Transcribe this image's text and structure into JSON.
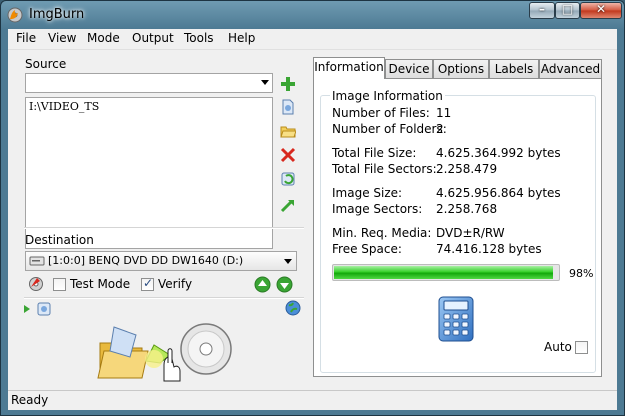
{
  "window": {
    "title": "ImgBurn"
  },
  "titlebar_buttons": {
    "minimize": "–",
    "maximize": "□",
    "close": "✕"
  },
  "menu": [
    "File",
    "View",
    "Mode",
    "Output",
    "Tools",
    "Help"
  ],
  "source": {
    "label": "Source",
    "combo_value": "",
    "entries": [
      "I:\\VIDEO_TS"
    ],
    "side_icons": [
      "add-file-icon",
      "browse-file-icon",
      "browse-folder-icon",
      "remove-icon",
      "refresh-icon",
      "calculate-icon"
    ]
  },
  "destination": {
    "label": "Destination",
    "drive": "[1:0:0] BENQ DVD DD DW1640 (D:)",
    "test_mode": {
      "label": "Test Mode",
      "checked": false
    },
    "verify": {
      "label": "Verify",
      "checked": true
    }
  },
  "tabs": [
    "Information",
    "Device",
    "Options",
    "Labels",
    "Advanced"
  ],
  "active_tab": "Information",
  "info": {
    "group_title": "Image Information",
    "rows": [
      {
        "label": "Number of Files:",
        "value": "11"
      },
      {
        "label": "Number of Folders:",
        "value": "2"
      },
      {
        "label": "Total File Size:",
        "value": "4.625.364.992 bytes"
      },
      {
        "label": "Total File Sectors:",
        "value": "2.258.479"
      },
      {
        "label": "Image Size:",
        "value": "4.625.956.864 bytes"
      },
      {
        "label": "Image Sectors:",
        "value": "2.258.768"
      },
      {
        "label": "Min. Req. Media:",
        "value": "DVD±R/RW"
      },
      {
        "label": "Free Space:",
        "value": "74.416.128 bytes"
      }
    ],
    "usage_percent": 98,
    "usage_label": "98%",
    "auto": {
      "label": "Auto",
      "checked": false
    }
  },
  "status": "Ready",
  "colors": {
    "progress": "#2fcc25",
    "accent": "#4d7a93"
  }
}
